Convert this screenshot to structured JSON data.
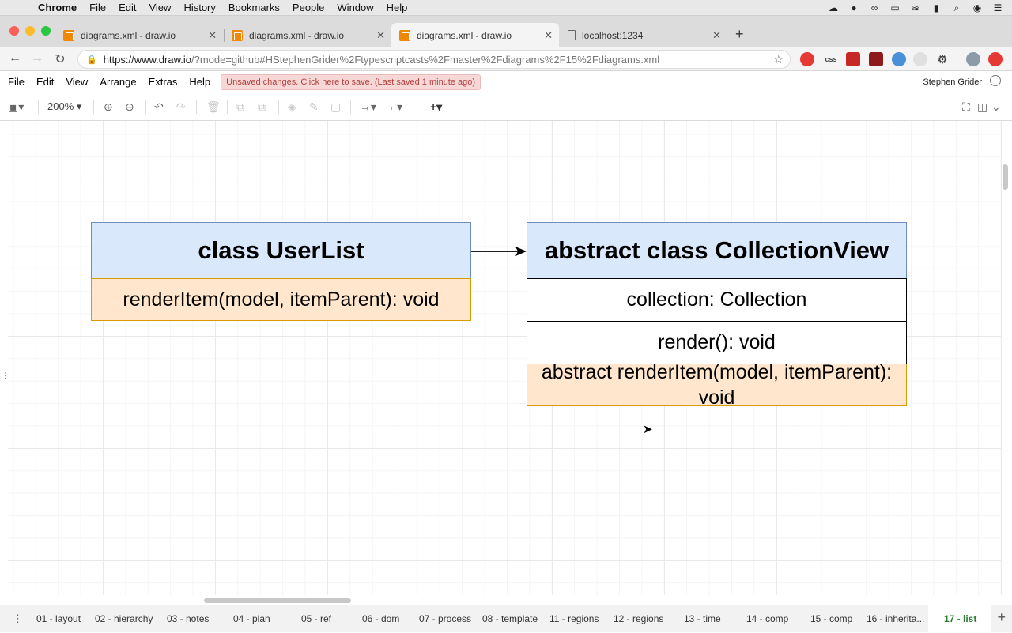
{
  "mac_menu": {
    "app": "Chrome",
    "items": [
      "File",
      "Edit",
      "View",
      "History",
      "Bookmarks",
      "People",
      "Window",
      "Help"
    ]
  },
  "browser_tabs": [
    {
      "title": "diagrams.xml - draw.io"
    },
    {
      "title": "diagrams.xml - draw.io"
    },
    {
      "title": "diagrams.xml - draw.io"
    },
    {
      "title": "localhost:1234"
    }
  ],
  "address": {
    "host": "https://www.draw.io",
    "path": "/?mode=github#HStephenGrider%2Ftypescriptcasts%2Fmaster%2Fdiagrams%2F15%2Fdiagrams.xml"
  },
  "extensions": {
    "css_label": "css"
  },
  "app_menu": {
    "items": [
      "File",
      "Edit",
      "View",
      "Arrange",
      "Extras",
      "Help"
    ],
    "unsaved": "Unsaved changes. Click here to save. (Last saved 1 minute ago)",
    "user": "Stephen Grider"
  },
  "toolbar": {
    "zoom": "200%"
  },
  "diagram": {
    "userlist_title": "class UserList",
    "userlist_method": "renderItem(model, itemParent): void",
    "collection_title": "abstract class CollectionView",
    "collection_prop": "collection: Collection",
    "collection_render": "render(): void",
    "collection_abstract": "abstract renderItem(model, itemParent): void"
  },
  "pages": [
    "01 - layout",
    "02 - hierarchy",
    "03 - notes",
    "04 - plan",
    "05 - ref",
    "06 - dom",
    "07 - process",
    "08 - template",
    "11 - regions",
    "12 - regions",
    "13 - time",
    "14 - comp",
    "15 - comp",
    "16 - inherita...",
    "17 - list"
  ],
  "active_page": "17 - list",
  "colors": {
    "class_header_fill": "#dae8fc",
    "class_header_stroke": "#6c8ebf",
    "method_fill": "#ffe6cc",
    "method_stroke": "#d79b00",
    "active_page": "#2e7d32"
  }
}
